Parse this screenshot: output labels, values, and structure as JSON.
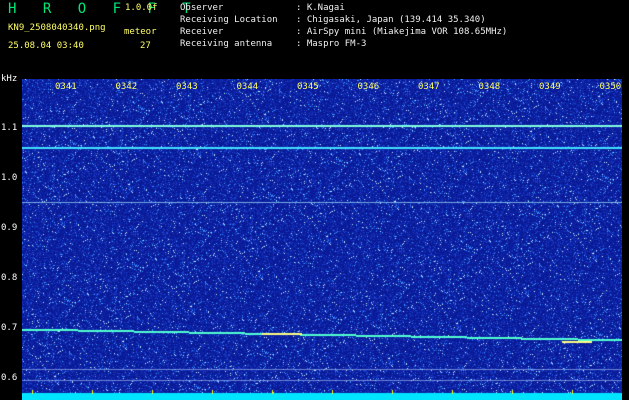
{
  "header": {
    "app_title": "H R O F F T",
    "version": "1.0.0f",
    "filename": "KN9_2508040340.png",
    "datetime": "25.08.04 03:40",
    "meteor_label": "meteor",
    "meteor_count": "27"
  },
  "info": {
    "observer_label": "Observer",
    "observer_value": ": K.Nagai",
    "location_label": "Receiving Location",
    "location_value": ": Chigasaki, Japan (139.414 35.340)",
    "receiver_label": "Receiver",
    "receiver_value": ": AirSpy mini (Miakejima VOR 108.65MHz)",
    "antenna_label": "Receiving antenna",
    "antenna_value": ": Maspro FM-3"
  },
  "axis": {
    "y_unit": "kHz",
    "y_ticks": [
      "1.1",
      "1.0",
      "0.9",
      "0.8",
      "0.7",
      "0.6"
    ],
    "x_ticks": [
      "0341",
      "0342",
      "0343",
      "0344",
      "0345",
      "0346",
      "0347",
      "0348",
      "0349",
      "0350"
    ]
  },
  "colors": {
    "background": "#000000",
    "spectrum_bg": "#0a1a9e",
    "title": "#00e676",
    "tick_label": "#ffff66",
    "baseline": "#00e5ff"
  }
}
